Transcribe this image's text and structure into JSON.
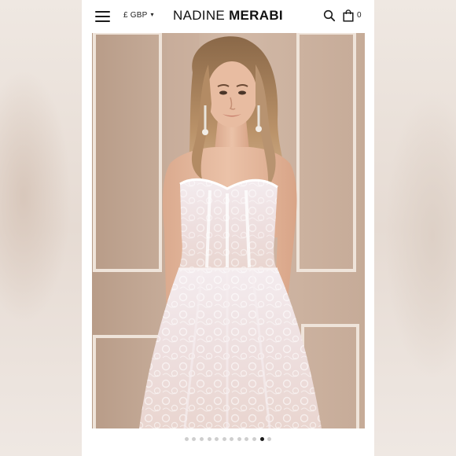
{
  "header": {
    "currency": "£ GBP",
    "brand_first": "NADINE",
    "brand_last": "MERABI",
    "cart_count": "0"
  },
  "icons": {
    "menu": "hamburger-icon",
    "currency_dropdown": "chevron-down-icon",
    "search": "search-icon",
    "cart": "shopping-bag-icon"
  },
  "carousel": {
    "total_slides": 12,
    "active_index": 10
  },
  "colors": {
    "brand_text": "#111111",
    "dot_active": "#1a1a1a",
    "dot_inactive": "#cfcfcf"
  }
}
